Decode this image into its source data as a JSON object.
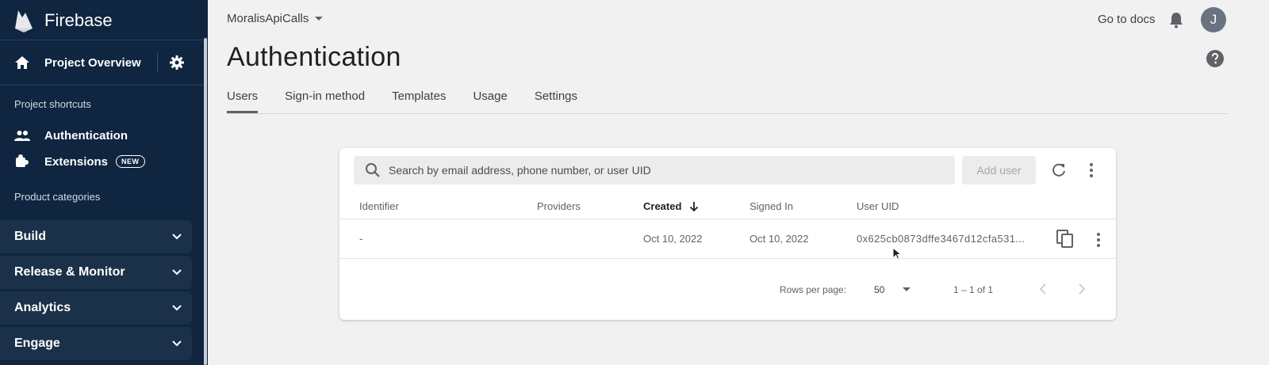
{
  "sidebar": {
    "brand": "Firebase",
    "project_overview": "Project Overview",
    "shortcuts_label": "Project shortcuts",
    "shortcuts": [
      {
        "label": "Authentication"
      },
      {
        "label": "Extensions",
        "badge": "NEW"
      }
    ],
    "categories_label": "Product categories",
    "categories": [
      {
        "label": "Build"
      },
      {
        "label": "Release & Monitor"
      },
      {
        "label": "Analytics"
      },
      {
        "label": "Engage"
      }
    ]
  },
  "header": {
    "project_name": "MoralisApiCalls",
    "go_to_docs": "Go to docs",
    "avatar_initial": "J"
  },
  "page": {
    "title": "Authentication",
    "tabs": [
      {
        "label": "Users",
        "active": true
      },
      {
        "label": "Sign-in method"
      },
      {
        "label": "Templates"
      },
      {
        "label": "Usage"
      },
      {
        "label": "Settings"
      }
    ]
  },
  "users_table": {
    "search_placeholder": "Search by email address, phone number, or user UID",
    "add_user_label": "Add user",
    "columns": [
      "Identifier",
      "Providers",
      "Created",
      "Signed In",
      "User UID"
    ],
    "rows": [
      {
        "identifier": "-",
        "providers": "",
        "created": "Oct 10, 2022",
        "signed_in": "Oct 10, 2022",
        "uid": "0x625cb0873dffe3467d12cfa531..."
      }
    ],
    "pagination": {
      "rows_per_page_label": "Rows per page:",
      "rows_per_page_value": "50",
      "range": "1 – 1 of 1"
    }
  },
  "colors": {
    "sidebar_bg": "#0f2540",
    "sidebar_category_bg": "#1b3149",
    "page_bg": "#f1f1f1"
  }
}
